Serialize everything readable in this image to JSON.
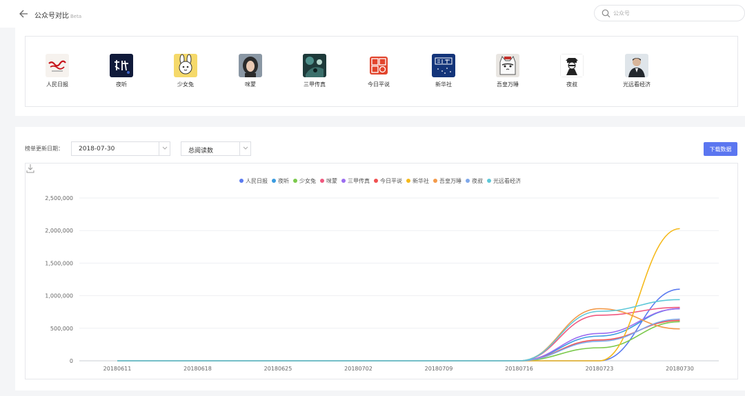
{
  "header": {
    "title": "公众号对比",
    "badge": "Beta"
  },
  "search": {
    "placeholder": "公众号",
    "value": ""
  },
  "accounts": [
    {
      "name": "人民日报",
      "icon": "people-daily-logo-icon"
    },
    {
      "name": "夜听",
      "icon": "night-listen-logo-icon"
    },
    {
      "name": "少女兔",
      "icon": "girl-rabbit-avatar-icon"
    },
    {
      "name": "咪蒙",
      "icon": "mimeng-avatar-icon"
    },
    {
      "name": "三甲传真",
      "icon": "sanjia-avatar-icon"
    },
    {
      "name": "今日平说",
      "icon": "jinri-pingshuo-logo-icon"
    },
    {
      "name": "新华社",
      "icon": "xinhua-logo-icon"
    },
    {
      "name": "吾皇万睡",
      "icon": "cat-avatar-icon"
    },
    {
      "name": "夜叔",
      "icon": "ye-shu-avatar-icon"
    },
    {
      "name": "光远看经济",
      "icon": "guangyuan-avatar-icon"
    }
  ],
  "filters": {
    "date_label": "榜单更新日期：",
    "date_value": "2018-07-30",
    "metric_value": "总阅读数",
    "download_label": "下载数据"
  },
  "chart_data": {
    "type": "line",
    "categories": [
      "20180611",
      "20180618",
      "20180625",
      "20180702",
      "20180709",
      "20180716",
      "20180723",
      "20180730"
    ],
    "y_ticks": [
      "0",
      "500,000",
      "1,000,000",
      "1,500,000",
      "2,000,000",
      "2,500,000"
    ],
    "ylim": [
      0,
      2500000
    ],
    "legend_position": "top-center",
    "grid": true,
    "series": [
      {
        "name": "人民日报",
        "color": "#5b7bf0",
        "values": [
          0,
          0,
          0,
          0,
          0,
          0,
          0,
          1100000
        ]
      },
      {
        "name": "夜听",
        "color": "#3a9be0",
        "values": [
          0,
          0,
          0,
          0,
          0,
          0,
          380000,
          800000
        ]
      },
      {
        "name": "少女兔",
        "color": "#7bc94c",
        "values": [
          0,
          0,
          0,
          0,
          0,
          0,
          200000,
          600000
        ]
      },
      {
        "name": "咪蒙",
        "color": "#f0577e",
        "values": [
          0,
          0,
          0,
          0,
          0,
          0,
          700000,
          820000
        ]
      },
      {
        "name": "三甲传真",
        "color": "#9b6cf0",
        "values": [
          0,
          0,
          0,
          0,
          0,
          0,
          420000,
          800000
        ]
      },
      {
        "name": "今日平说",
        "color": "#f05050",
        "values": [
          0,
          0,
          0,
          0,
          0,
          0,
          320000,
          620000
        ]
      },
      {
        "name": "新华社",
        "color": "#f5b91a",
        "values": [
          0,
          0,
          0,
          0,
          0,
          0,
          0,
          2030000
        ]
      },
      {
        "name": "吾皇万睡",
        "color": "#f39a4a",
        "values": [
          0,
          0,
          0,
          0,
          0,
          0,
          800000,
          490000
        ]
      },
      {
        "name": "夜叔",
        "color": "#7fa8ea",
        "values": [
          0,
          0,
          0,
          0,
          0,
          0,
          300000,
          640000
        ]
      },
      {
        "name": "光远看经济",
        "color": "#5ec8d8",
        "values": [
          0,
          0,
          0,
          0,
          0,
          0,
          760000,
          940000
        ]
      }
    ]
  }
}
